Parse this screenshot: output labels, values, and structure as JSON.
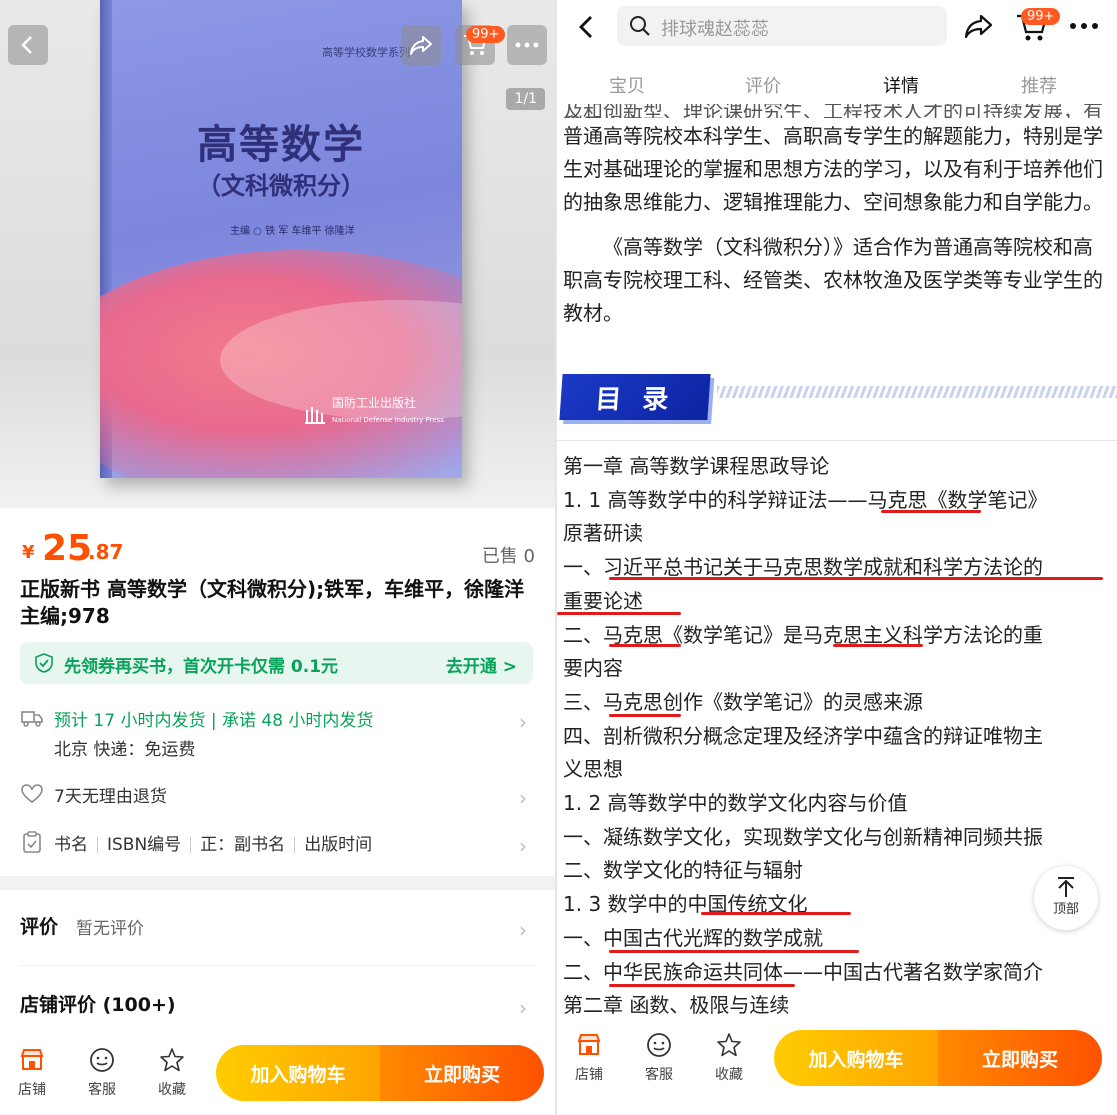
{
  "left": {
    "book": {
      "series": "高等学校数学系列",
      "title": "高等数学",
      "subtitle": "（文科微积分）",
      "authors": "主编 ○ 铁 军   车维平   徐隆洋",
      "publisher": "国防工业出版社",
      "publisher_en": "National Defense Industry Press"
    },
    "cart_badge": "99+",
    "pager": "1/1",
    "price": {
      "symbol": "¥",
      "integer": "25",
      "decimal": ".87"
    },
    "sold": "已售 0",
    "title": "正版新书 高等数学（文科微积分);铁军，车维平，徐隆洋主编;978",
    "coupon": {
      "text": "先领券再买书，首次开卡仅需 0.1元",
      "action": "去开通 >"
    },
    "shipping": {
      "line1": "预计 17 小时内发货 | 承诺 48 小时内发货",
      "line2": "北京  快递：免运费"
    },
    "returns": "7天无理由退货",
    "params": [
      "书名",
      "ISBN编号",
      "正：副书名",
      "出版时间"
    ],
    "review": {
      "label": "评价",
      "sub": "暂无评价"
    },
    "shop_review": "店铺评价 (100+)",
    "bottom": {
      "shop": "店铺",
      "service": "客服",
      "fav": "收藏",
      "add_cart": "加入购物车",
      "buy": "立即购买"
    }
  },
  "right": {
    "search_placeholder": "排球魂赵蕊蕊",
    "cart_badge": "99+",
    "tabs": [
      "宝贝",
      "评价",
      "详情",
      "推荐"
    ],
    "cut_line": "及和创新型、理论课研究生、工程技术人才的可持续发展，有利于提高",
    "para1": "普通高等院校本科学生、高职高专学生的解题能力，特别是学生对基础理论的掌握和思想方法的学习，以及有利于培养他们的抽象思维能力、逻辑推理能力、空间想象能力和自学能力。",
    "para2": "《高等数学（文科微积分）》适合作为普通高等院校和高职高专院校理工科、经管类、农林牧渔及医学类等专业学生的教材。",
    "mulu": "目 录",
    "toc": [
      "第一章 高等数学课程思政导论",
      "1. 1 高等数学中的科学辩证法——马克思《数学笔记》",
      "原著研读",
      "一、习近平总书记关于马克思数学成就和科学方法论的",
      "重要论述",
      "二、马克思《数学笔记》是马克思主义科学方法论的重",
      "要内容",
      "三、马克思创作《数学笔记》的灵感来源",
      "四、剖析微积分概念定理及经济学中蕴含的辩证唯物主",
      "义思想",
      "1. 2 高等数学中的数学文化内容与价值",
      "一、凝练数学文化，实现数学文化与创新精神同频共振",
      "二、数学文化的特征与辐射",
      "1. 3 数学中的中国传统文化",
      "一、中国古代光辉的数学成就",
      "二、中华民族命运共同体——中国古代著名数学家简介",
      "第二章 函数、极限与连续"
    ],
    "to_top": "顶部",
    "bottom": {
      "shop": "店铺",
      "service": "客服",
      "fav": "收藏",
      "add_cart": "加入购物车",
      "buy": "立即购买"
    }
  },
  "colors": {
    "orange": "#ff5000",
    "green": "#08a35a",
    "underline": "#e01b1b",
    "mulu_blue": "#1c3ac8"
  }
}
